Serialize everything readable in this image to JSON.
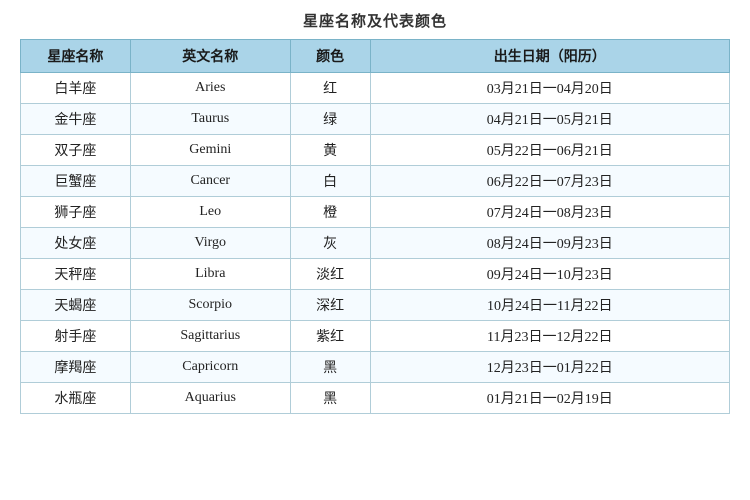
{
  "title": "星座名称及代表颜色",
  "headers": {
    "name": "星座名称",
    "en_name": "英文名称",
    "color": "颜色",
    "date": "出生日期（阳历）"
  },
  "rows": [
    {
      "name": "白羊座",
      "en": "Aries",
      "color": "红",
      "date": "03月21日一04月20日"
    },
    {
      "name": "金牛座",
      "en": "Taurus",
      "color": "绿",
      "date": "04月21日一05月21日"
    },
    {
      "name": "双子座",
      "en": "Gemini",
      "color": "黄",
      "date": "05月22日一06月21日"
    },
    {
      "name": "巨蟹座",
      "en": "Cancer",
      "color": "白",
      "date": "06月22日一07月23日"
    },
    {
      "name": "狮子座",
      "en": "Leo",
      "color": "橙",
      "date": "07月24日一08月23日"
    },
    {
      "name": "处女座",
      "en": "Virgo",
      "color": "灰",
      "date": "08月24日一09月23日"
    },
    {
      "name": "天秤座",
      "en": "Libra",
      "color": "淡红",
      "date": "09月24日一10月23日"
    },
    {
      "name": "天蝎座",
      "en": "Scorpio",
      "color": "深红",
      "date": "10月24日一11月22日"
    },
    {
      "name": "射手座",
      "en": "Sagittarius",
      "color": "紫红",
      "date": "11月23日一12月22日"
    },
    {
      "name": "摩羯座",
      "en": "Capricorn",
      "color": "黑",
      "date": "12月23日一01月22日"
    },
    {
      "name": "水瓶座",
      "en": "Aquarius",
      "color": "黑",
      "date": "01月21日一02月19日"
    }
  ]
}
